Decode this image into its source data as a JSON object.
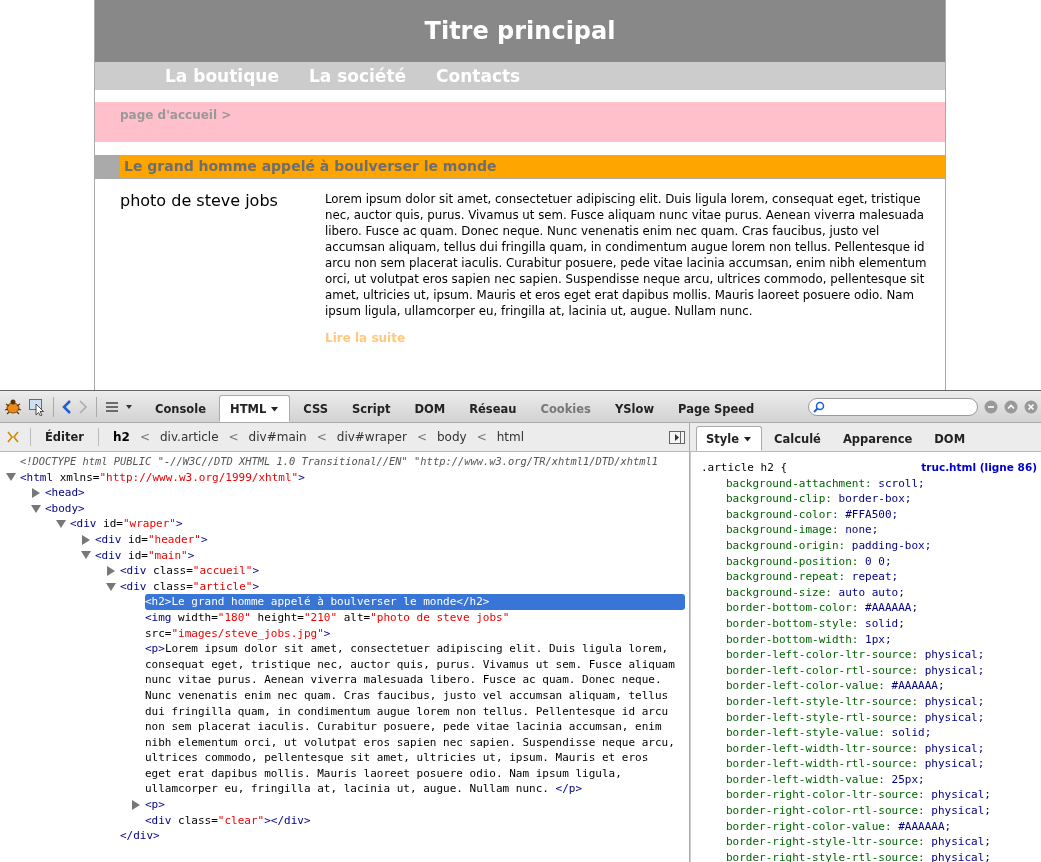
{
  "site": {
    "title": "Titre principal",
    "nav": [
      {
        "label": "La boutique"
      },
      {
        "label": "La société"
      },
      {
        "label": "Contacts"
      }
    ],
    "breadcrumb": "page d'accueil >",
    "heading": "Le grand homme appelé à boulverser le monde",
    "image_alt": "photo de steve jobs",
    "paragraph": "Lorem ipsum dolor sit amet, consectetuer adipiscing elit. Duis ligula lorem, consequat eget, tristique nec, auctor quis, purus. Vivamus ut sem. Fusce aliquam nunc vitae purus. Aenean viverra malesuada libero. Fusce ac quam. Donec neque. Nunc venenatis enim nec quam. Cras faucibus, justo vel accumsan aliquam, tellus dui fringilla quam, in condimentum augue lorem non tellus. Pellentesque id arcu non sem placerat iaculis. Curabitur posuere, pede vitae lacinia accumsan, enim nibh elementum orci, ut volutpat eros sapien nec sapien. Suspendisse neque arcu, ultrices commodo, pellentesque sit amet, ultricies ut, ipsum. Mauris et eros eget erat dapibus mollis. Mauris laoreet posuere odio. Nam ipsum ligula, ullamcorper eu, fringilla at, lacinia ut, augue. Nullam nunc.",
    "read_more": "Lire la suite"
  },
  "devtools": {
    "tabs": [
      {
        "label": "Console",
        "selected": false,
        "disabled": false,
        "menu": false
      },
      {
        "label": "HTML",
        "selected": true,
        "disabled": false,
        "menu": true
      },
      {
        "label": "CSS",
        "selected": false,
        "disabled": false,
        "menu": false
      },
      {
        "label": "Script",
        "selected": false,
        "disabled": false,
        "menu": false
      },
      {
        "label": "DOM",
        "selected": false,
        "disabled": false,
        "menu": false
      },
      {
        "label": "Réseau",
        "selected": false,
        "disabled": false,
        "menu": false
      },
      {
        "label": "Cookies",
        "selected": false,
        "disabled": true,
        "menu": false
      },
      {
        "label": "YSlow",
        "selected": false,
        "disabled": false,
        "menu": false
      },
      {
        "label": "Page Speed",
        "selected": false,
        "disabled": false,
        "menu": false
      }
    ],
    "edit_button": "Éditer",
    "breadcrumb_separator": "<",
    "breadcrumb": [
      {
        "label": "h2",
        "selected": true
      },
      {
        "label": "div.article",
        "selected": false
      },
      {
        "label": "div#main",
        "selected": false
      },
      {
        "label": "div#wraper",
        "selected": false
      },
      {
        "label": "body",
        "selected": false
      },
      {
        "label": "html",
        "selected": false
      }
    ],
    "side_tabs": [
      {
        "label": "Style",
        "selected": true,
        "menu": true
      },
      {
        "label": "Calculé",
        "selected": false,
        "menu": false
      },
      {
        "label": "Apparence",
        "selected": false,
        "menu": false
      },
      {
        "label": "DOM",
        "selected": false,
        "menu": false
      }
    ],
    "html_tree": [
      {
        "kind": "doctype",
        "selected": false,
        "tokens": [
          {
            "kind": "doctype",
            "text": "<!DOCTYPE html PUBLIC \"-//W3C//DTD XHTML 1.0 Transitional//EN\" \"http://www.w3.org/TR/xhtml1/DTD/xhtml1"
          }
        ]
      },
      {
        "kind": "element",
        "expanded": true,
        "selected": false,
        "tokens": [
          {
            "kind": "tag",
            "text": "<html"
          },
          {
            "kind": "attr",
            "text": " xmlns="
          },
          {
            "kind": "value",
            "text": "\"http://www.w3.org/1999/xhtml\""
          },
          {
            "kind": "tag",
            "text": ">"
          }
        ],
        "children": [
          {
            "kind": "element",
            "expanded": false,
            "selected": false,
            "tokens": [
              {
                "kind": "tag",
                "text": "<head>"
              }
            ]
          },
          {
            "kind": "element",
            "expanded": true,
            "selected": false,
            "tokens": [
              {
                "kind": "tag",
                "text": "<body>"
              }
            ],
            "children": [
              {
                "kind": "element",
                "expanded": true,
                "selected": false,
                "tokens": [
                  {
                    "kind": "tag",
                    "text": "<div"
                  },
                  {
                    "kind": "attr",
                    "text": " id="
                  },
                  {
                    "kind": "value",
                    "text": "\"wraper\""
                  },
                  {
                    "kind": "tag",
                    "text": ">"
                  }
                ],
                "children": [
                  {
                    "kind": "element",
                    "expanded": false,
                    "selected": false,
                    "tokens": [
                      {
                        "kind": "tag",
                        "text": "<div"
                      },
                      {
                        "kind": "attr",
                        "text": " id="
                      },
                      {
                        "kind": "value",
                        "text": "\"header\""
                      },
                      {
                        "kind": "tag",
                        "text": ">"
                      }
                    ]
                  },
                  {
                    "kind": "element",
                    "expanded": true,
                    "selected": false,
                    "tokens": [
                      {
                        "kind": "tag",
                        "text": "<div"
                      },
                      {
                        "kind": "attr",
                        "text": " id="
                      },
                      {
                        "kind": "value",
                        "text": "\"main\""
                      },
                      {
                        "kind": "tag",
                        "text": ">"
                      }
                    ],
                    "children": [
                      {
                        "kind": "element",
                        "expanded": false,
                        "selected": false,
                        "tokens": [
                          {
                            "kind": "tag",
                            "text": "<div"
                          },
                          {
                            "kind": "attr",
                            "text": " class="
                          },
                          {
                            "kind": "value",
                            "text": "\"accueil\""
                          },
                          {
                            "kind": "tag",
                            "text": ">"
                          }
                        ]
                      },
                      {
                        "kind": "element",
                        "expanded": true,
                        "selected": false,
                        "tokens": [
                          {
                            "kind": "tag",
                            "text": "<div"
                          },
                          {
                            "kind": "attr",
                            "text": " class="
                          },
                          {
                            "kind": "value",
                            "text": "\"article\""
                          },
                          {
                            "kind": "tag",
                            "text": ">"
                          }
                        ],
                        "children": [
                          {
                            "kind": "leaf",
                            "selected": true,
                            "tokens": [
                              {
                                "kind": "tag",
                                "text": "<h2>"
                              },
                              {
                                "kind": "text",
                                "text": "Le grand homme appelé à boulverser le monde"
                              },
                              {
                                "kind": "tag",
                                "text": "</h2>"
                              }
                            ]
                          },
                          {
                            "kind": "leaf",
                            "selected": false,
                            "tokens": [
                              {
                                "kind": "tag",
                                "text": "<img"
                              },
                              {
                                "kind": "attr",
                                "text": " width="
                              },
                              {
                                "kind": "value",
                                "text": "\"180\""
                              },
                              {
                                "kind": "attr",
                                "text": " height="
                              },
                              {
                                "kind": "value",
                                "text": "\"210\""
                              },
                              {
                                "kind": "attr",
                                "text": " alt="
                              },
                              {
                                "kind": "value",
                                "text": "\"photo de steve jobs\""
                              },
                              {
                                "kind": "attr",
                                "text": " src="
                              },
                              {
                                "kind": "value",
                                "text": "\"images/steve_jobs.jpg\""
                              },
                              {
                                "kind": "tag",
                                "text": ">"
                              }
                            ]
                          },
                          {
                            "kind": "leaf",
                            "selected": false,
                            "tokens": [
                              {
                                "kind": "tag",
                                "text": "<p>"
                              },
                              {
                                "kind": "text",
                                "text": "Lorem ipsum dolor sit amet, consectetuer adipiscing elit. Duis ligula lorem, consequat eget, tristique nec, auctor quis, purus. Vivamus ut sem. Fusce aliquam nunc vitae purus. Aenean viverra malesuada libero. Fusce ac quam. Donec neque. Nunc venenatis enim nec quam. Cras faucibus, justo vel accumsan aliquam, tellus dui fringilla quam, in condimentum augue lorem non tellus. Pellentesque id arcu non sem placerat iaculis. Curabitur posuere, pede vitae lacinia accumsan, enim nibh elementum orci, ut volutpat eros sapien nec sapien. Suspendisse neque arcu, ultrices commodo, pellentesque sit amet, ultricies ut, ipsum. Mauris et eros eget erat dapibus mollis. Mauris laoreet posuere odio. Nam ipsum ligula, ullamcorper eu, fringilla at, lacinia ut, augue. Nullam nunc. "
                              },
                              {
                                "kind": "tag",
                                "text": "</p>"
                              }
                            ]
                          },
                          {
                            "kind": "element",
                            "expanded": false,
                            "selected": false,
                            "tokens": [
                              {
                                "kind": "tag",
                                "text": "<p>"
                              }
                            ]
                          },
                          {
                            "kind": "leaf",
                            "selected": false,
                            "tokens": [
                              {
                                "kind": "tag",
                                "text": "<div"
                              },
                              {
                                "kind": "attr",
                                "text": " class="
                              },
                              {
                                "kind": "value",
                                "text": "\"clear\""
                              },
                              {
                                "kind": "tag",
                                "text": "></div>"
                              }
                            ]
                          }
                        ]
                      },
                      {
                        "kind": "close",
                        "selected": false,
                        "tokens": [
                          {
                            "kind": "tag",
                            "text": "</div>"
                          }
                        ]
                      }
                    ]
                  }
                ]
              }
            ]
          }
        ]
      }
    ],
    "css_rule": {
      "selector": ".article h2 {",
      "source": "truc.html (ligne 86)",
      "declarations": [
        {
          "name": "background-attachment:",
          "value": "scroll;"
        },
        {
          "name": "background-clip:",
          "value": "border-box;"
        },
        {
          "name": "background-color:",
          "value": "#FFA500;"
        },
        {
          "name": "background-image:",
          "value": "none;"
        },
        {
          "name": "background-origin:",
          "value": "padding-box;"
        },
        {
          "name": "background-position:",
          "value": "0 0;"
        },
        {
          "name": "background-repeat:",
          "value": "repeat;"
        },
        {
          "name": "background-size:",
          "value": "auto auto;"
        },
        {
          "name": "border-bottom-color:",
          "value": "#AAAAAA;"
        },
        {
          "name": "border-bottom-style:",
          "value": "solid;"
        },
        {
          "name": "border-bottom-width:",
          "value": "1px;"
        },
        {
          "name": "border-left-color-ltr-source:",
          "value": "physical;"
        },
        {
          "name": "border-left-color-rtl-source:",
          "value": "physical;"
        },
        {
          "name": "border-left-color-value:",
          "value": "#AAAAAA;"
        },
        {
          "name": "border-left-style-ltr-source:",
          "value": "physical;"
        },
        {
          "name": "border-left-style-rtl-source:",
          "value": "physical;"
        },
        {
          "name": "border-left-style-value:",
          "value": "solid;"
        },
        {
          "name": "border-left-width-ltr-source:",
          "value": "physical;"
        },
        {
          "name": "border-left-width-rtl-source:",
          "value": "physical;"
        },
        {
          "name": "border-left-width-value:",
          "value": "25px;"
        },
        {
          "name": "border-right-color-ltr-source:",
          "value": "physical;"
        },
        {
          "name": "border-right-color-rtl-source:",
          "value": "physical;"
        },
        {
          "name": "border-right-color-value:",
          "value": "#AAAAAA;"
        },
        {
          "name": "border-right-style-ltr-source:",
          "value": "physical;"
        },
        {
          "name": "border-right-style-rtl-source:",
          "value": "physical;"
        }
      ]
    }
  }
}
